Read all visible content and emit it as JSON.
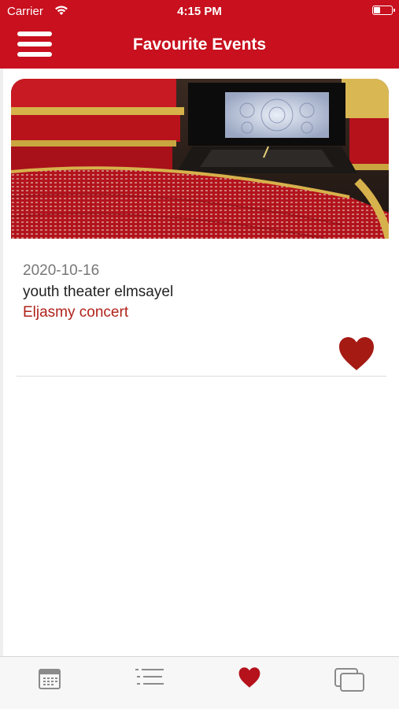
{
  "status_bar": {
    "carrier": "Carrier",
    "time": "4:15 PM"
  },
  "header": {
    "title": "Favourite Events"
  },
  "events": [
    {
      "date": "2020-10-16",
      "venue": "youth theater elmsayel",
      "name": "Eljasmy concert",
      "favourited": true
    }
  ],
  "tabs": [
    {
      "icon": "calendar-icon"
    },
    {
      "icon": "list-icon"
    },
    {
      "icon": "heart-icon",
      "active": true
    },
    {
      "icon": "gallery-icon"
    }
  ],
  "colors": {
    "brand": "#c8101e",
    "accent_text": "#b0231a",
    "heart": "#a61a14"
  }
}
